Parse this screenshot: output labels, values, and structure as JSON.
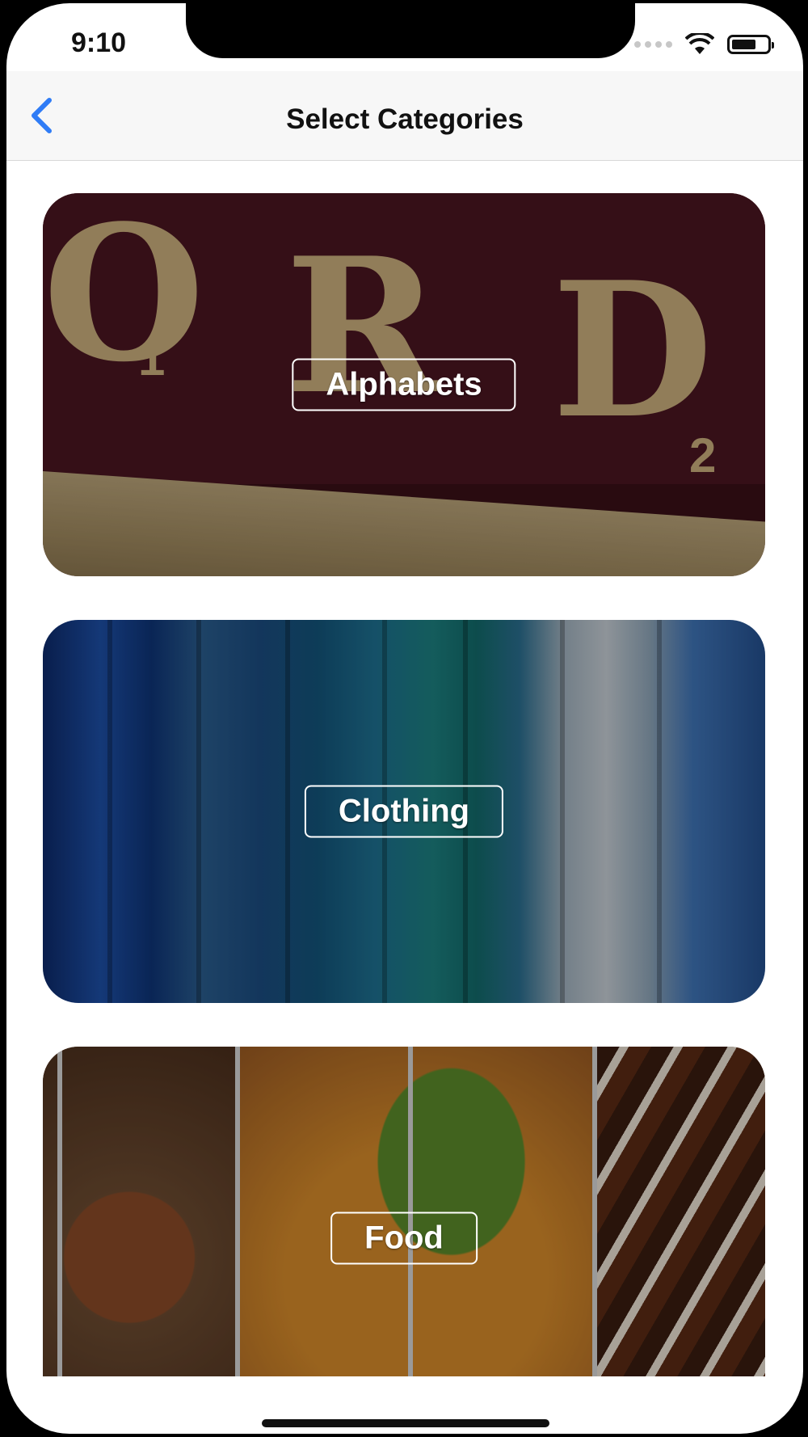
{
  "status_bar": {
    "time": "9:10",
    "icons": [
      "cellular-signal-icon",
      "wifi-icon",
      "battery-icon"
    ]
  },
  "nav": {
    "back_icon": "chevron-left-icon",
    "title": "Select Categories",
    "accent": "#2f7cf6"
  },
  "categories": [
    {
      "label": "Alphabets"
    },
    {
      "label": "Clothing"
    },
    {
      "label": "Food"
    }
  ]
}
